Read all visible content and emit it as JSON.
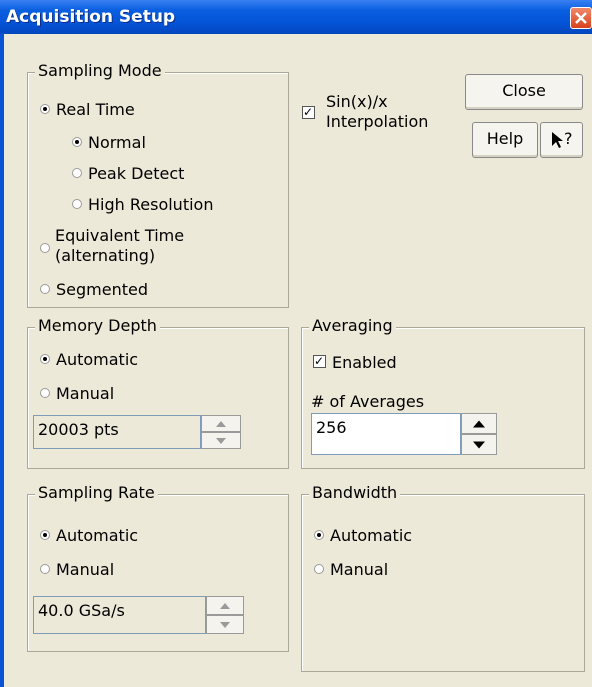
{
  "window": {
    "title": "Acquisition Setup"
  },
  "sampling_mode": {
    "legend": "Sampling Mode",
    "options": [
      {
        "label": "Real Time",
        "selected": true
      },
      {
        "label": "Normal",
        "selected": true
      },
      {
        "label": "Peak Detect",
        "selected": false
      },
      {
        "label": "High Resolution",
        "selected": false
      },
      {
        "label": "Equivalent Time",
        "label2": "(alternating)",
        "selected": false
      },
      {
        "label": "Segmented",
        "selected": false
      }
    ]
  },
  "interpolation": {
    "label1": "Sin(x)/x",
    "label2": "Interpolation",
    "checked": true
  },
  "buttons": {
    "close": "Close",
    "help": "Help",
    "whats_this": "?"
  },
  "memory_depth": {
    "legend": "Memory Depth",
    "automatic": "Automatic",
    "manual": "Manual",
    "value": "20003 pts"
  },
  "averaging": {
    "legend": "Averaging",
    "enabled_label": "Enabled",
    "enabled": true,
    "count_label": "# of Averages",
    "count": "256"
  },
  "sampling_rate": {
    "legend": "Sampling Rate",
    "automatic": "Automatic",
    "manual": "Manual",
    "value": "40.0 GSa/s"
  },
  "bandwidth": {
    "legend": "Bandwidth",
    "automatic": "Automatic",
    "manual": "Manual"
  }
}
